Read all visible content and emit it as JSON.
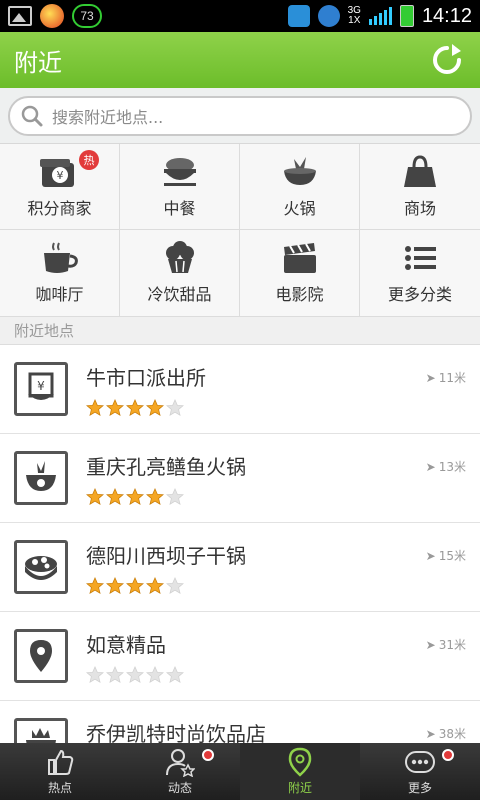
{
  "status_bar": {
    "badge_value": "73",
    "network_top": "3G",
    "network_bottom": "1X",
    "time": "14:12"
  },
  "header": {
    "title": "附近"
  },
  "search": {
    "placeholder": "搜索附近地点..."
  },
  "categories": [
    {
      "label": "积分商家",
      "icon": "wallet-icon",
      "badge": "热"
    },
    {
      "label": "中餐",
      "icon": "rice-bowl-icon"
    },
    {
      "label": "火锅",
      "icon": "hotpot-icon"
    },
    {
      "label": "商场",
      "icon": "shopping-bag-icon"
    },
    {
      "label": "咖啡厅",
      "icon": "coffee-cup-icon"
    },
    {
      "label": "冷饮甜品",
      "icon": "cupcake-icon"
    },
    {
      "label": "电影院",
      "icon": "clapperboard-icon"
    },
    {
      "label": "更多分类",
      "icon": "list-icon"
    }
  ],
  "section_title": "附近地点",
  "places": [
    {
      "name": "牛市口派出所",
      "distance": "11米",
      "rating": 4,
      "icon": "bank-building-icon"
    },
    {
      "name": "重庆孔亮鳝鱼火锅",
      "distance": "13米",
      "rating": 4,
      "icon": "hotpot-icon"
    },
    {
      "name": "德阳川西坝子干锅",
      "distance": "15米",
      "rating": 4,
      "icon": "dish-icon"
    },
    {
      "name": "如意精品",
      "distance": "31米",
      "rating": 0,
      "icon": "location-pin-icon"
    },
    {
      "name": "乔伊凯特时尚饮品店",
      "distance": "38米",
      "rating": 0,
      "icon": "bowl-icon"
    }
  ],
  "tabs": [
    {
      "label": "热点",
      "icon": "thumbs-up-icon",
      "dot": false
    },
    {
      "label": "动态",
      "icon": "user-star-icon",
      "dot": true
    },
    {
      "label": "附近",
      "icon": "location-pin-icon",
      "dot": false,
      "active": true
    },
    {
      "label": "更多",
      "icon": "more-dots-icon",
      "dot": true
    }
  ],
  "colors": {
    "header_green": "#7cc43a",
    "star_gold": "#f5a623",
    "badge_red": "#e23b3b"
  }
}
